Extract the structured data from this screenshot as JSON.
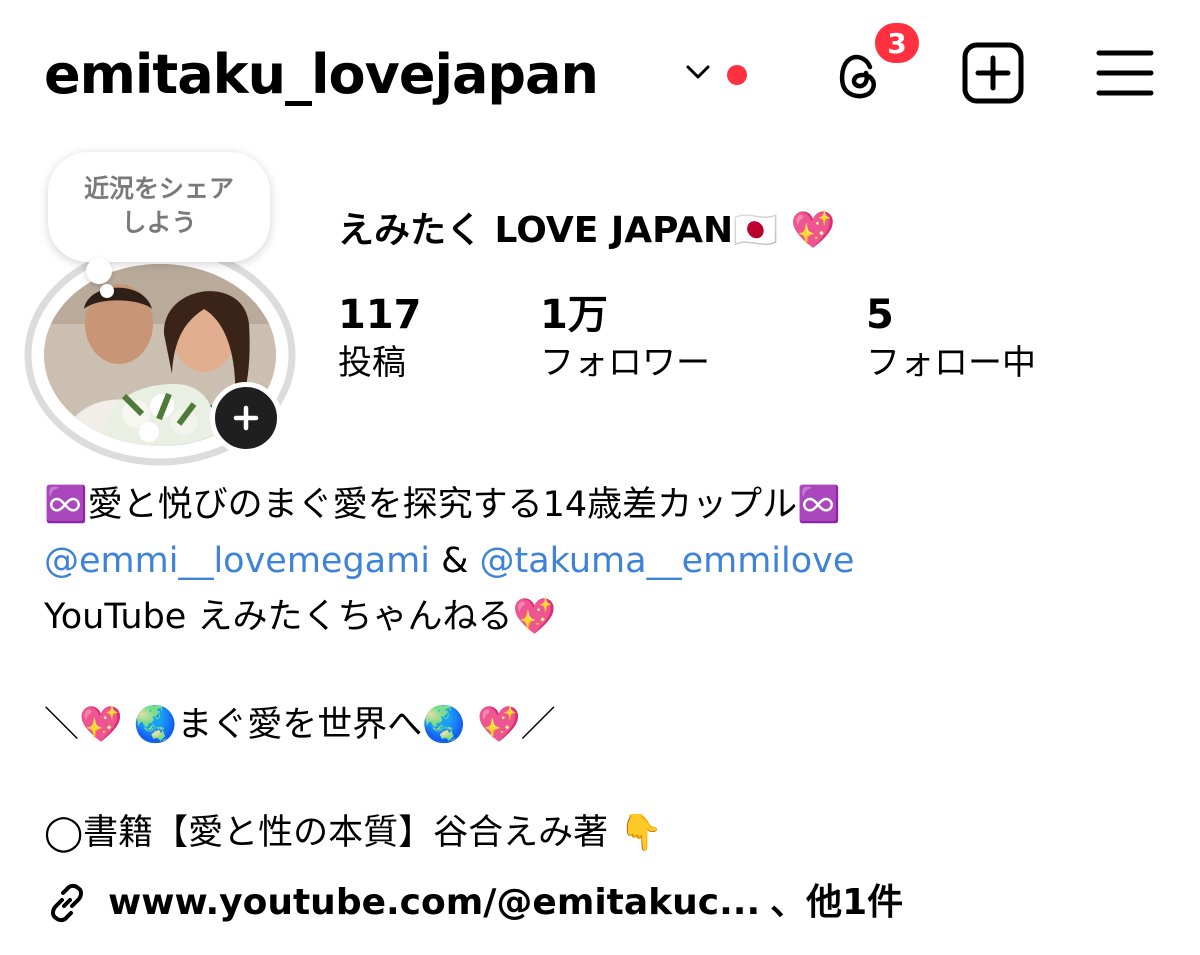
{
  "header": {
    "username": "emitaku_lovejapan",
    "notification_count": "3"
  },
  "avatar": {
    "note_bubble": "近況をシェア\nしよう"
  },
  "profile": {
    "display_name": "えみたく LOVE JAPAN🇯🇵 💖",
    "stats": [
      {
        "value": "117",
        "label": "投稿"
      },
      {
        "value": "1万",
        "label": "フォロワー"
      },
      {
        "value": "5",
        "label": "フォロー中"
      }
    ]
  },
  "bio": {
    "line1": "♾️愛と悦びのまぐ愛を探究する14歳差カップル♾️",
    "mention1": "@emmi__lovemegami",
    "amp": " & ",
    "mention2": "@takuma__emmilove",
    "line3": "YouTube えみたくちゃんねる💖",
    "line4": "＼💖 🌏まぐ愛を世界へ🌏 💖／",
    "line5": "◯書籍【愛と性の本質】谷合えみ著 👇"
  },
  "link": {
    "text": "www.youtube.com/@emitakuc...",
    "suffix": "、他1件"
  },
  "colors": {
    "accent_red": "#ff3040",
    "mention_blue": "#3f83d6"
  },
  "icons": [
    "chevron-down-icon",
    "threads-icon",
    "new-post-icon",
    "menu-icon",
    "add-story-icon",
    "link-icon"
  ]
}
